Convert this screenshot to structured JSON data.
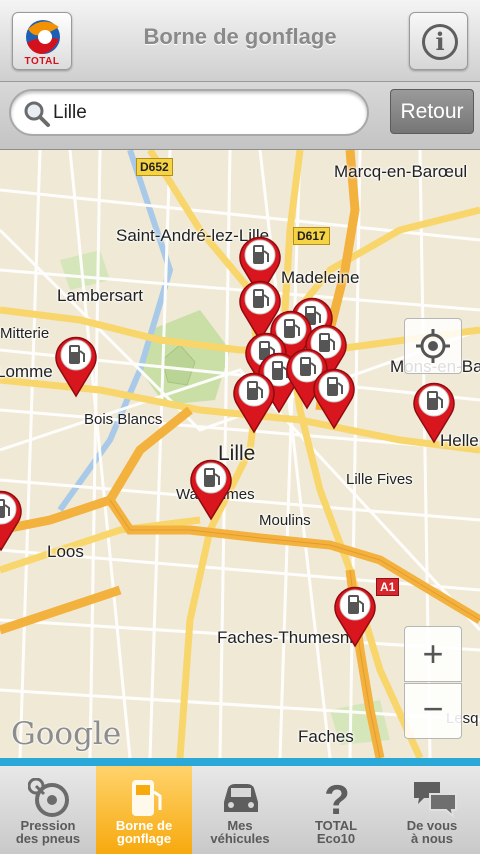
{
  "header": {
    "logo_text": "TOTAL",
    "title": "Borne de gonflage",
    "info_label": "i"
  },
  "search": {
    "value": "Lille",
    "back_label": "Retour"
  },
  "map": {
    "places": [
      {
        "key": "marcq",
        "label": "Marcq-en-Barœul"
      },
      {
        "key": "saint_andre",
        "label": "Saint-André-lez-Lille"
      },
      {
        "key": "madeleine",
        "label": "Madeleine"
      },
      {
        "key": "lambersart",
        "label": "Lambersart"
      },
      {
        "key": "mitterie",
        "label": "Mitterie"
      },
      {
        "key": "lomme",
        "label": "Lomme"
      },
      {
        "key": "bois_blancs",
        "label": "Bois Blancs"
      },
      {
        "key": "mons",
        "label": "Mons-en-Ba"
      },
      {
        "key": "hellemmes",
        "label": "Hellen"
      },
      {
        "key": "lille",
        "label": "Lille"
      },
      {
        "key": "wazemmes",
        "label": "Wazemmes"
      },
      {
        "key": "lille_fives",
        "label": "Lille Fives"
      },
      {
        "key": "moulins",
        "label": "Moulins"
      },
      {
        "key": "loos",
        "label": "Loos"
      },
      {
        "key": "faches_thumesnil",
        "label": "Faches-Thumesnil"
      },
      {
        "key": "faches",
        "label": "Faches"
      },
      {
        "key": "lesquin",
        "label": "Lesq"
      }
    ],
    "road_badges": [
      "D652",
      "D617",
      "A1"
    ],
    "attribution": "Google",
    "zoom_in": "+",
    "zoom_out": "−",
    "pin_icon": "inflation-station-pin-icon",
    "pin_color": "#d9161d"
  },
  "tabs": [
    {
      "label_line1": "Pression",
      "label_line2": "des pneus",
      "icon": "tire-pressure-gauge-icon",
      "active": false
    },
    {
      "label_line1": "Borne de",
      "label_line2": "gonflage",
      "icon": "inflation-station-icon",
      "active": true
    },
    {
      "label_line1": "Mes",
      "label_line2": "véhicules",
      "icon": "car-icon",
      "active": false
    },
    {
      "label_line1": "TOTAL",
      "label_line2": "Eco10",
      "icon": "question-mark-icon",
      "active": false
    },
    {
      "label_line1": "De vous",
      "label_line2": "à nous",
      "icon": "speech-bubbles-icon",
      "active": false
    }
  ],
  "colors": {
    "accent_blue": "#2aa8d8",
    "active_tab": "#f7a90e",
    "total_red": "#d4111b"
  }
}
